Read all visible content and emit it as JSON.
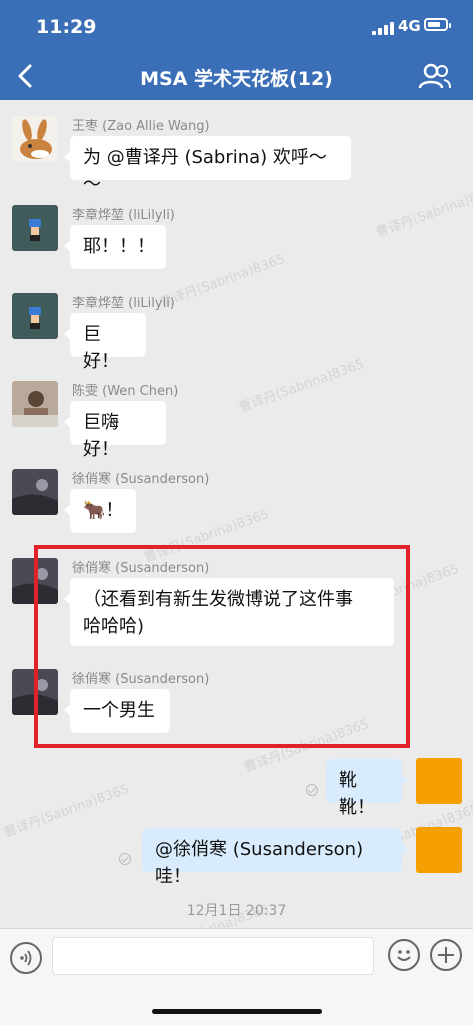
{
  "status": {
    "time": "11:29",
    "network": "4G"
  },
  "header": {
    "title": "MSA 学术天花板(12)"
  },
  "watermark_text": "曹译丹(Sabrina)8365",
  "messages": [
    {
      "sender": "王枣 (Zao Allie Wang)",
      "text": "为 @曹译丹 (Sabrina) 欢呼～～",
      "avatar": "rabbit-avatar"
    },
    {
      "sender": "李章烨堃 (liLilyli)",
      "text": "耶！！！",
      "avatar": "pixel-character-avatar"
    },
    {
      "sender": "李章烨堃 (liLilyli)",
      "text": "巨好！",
      "avatar": "pixel-character-avatar"
    },
    {
      "sender": "陈雯 (Wen Chen)",
      "text": "巨嗨好！",
      "avatar": "photo-avatar"
    },
    {
      "sender": "徐俏寒 (Susanderson)",
      "text": "🐂！",
      "avatar": "dark-photo-avatar"
    },
    {
      "sender": "徐俏寒 (Susanderson)",
      "text_line1": "（还看到有新生发微博说了这件事",
      "text_line2": "哈哈哈)",
      "avatar": "dark-photo-avatar"
    },
    {
      "sender": "徐俏寒 (Susanderson)",
      "text": "一个男生",
      "avatar": "dark-photo-avatar"
    }
  ],
  "my_messages": [
    {
      "text": "靴靴！"
    },
    {
      "text": "@徐俏寒 (Susanderson) 哇！"
    }
  ],
  "timestamp": "12月1日 20:37",
  "colors": {
    "header": "#3a6fb8",
    "highlight": "#e3212b",
    "my_bubble": "#d9ecfd",
    "my_avatar": "#f5a000"
  }
}
